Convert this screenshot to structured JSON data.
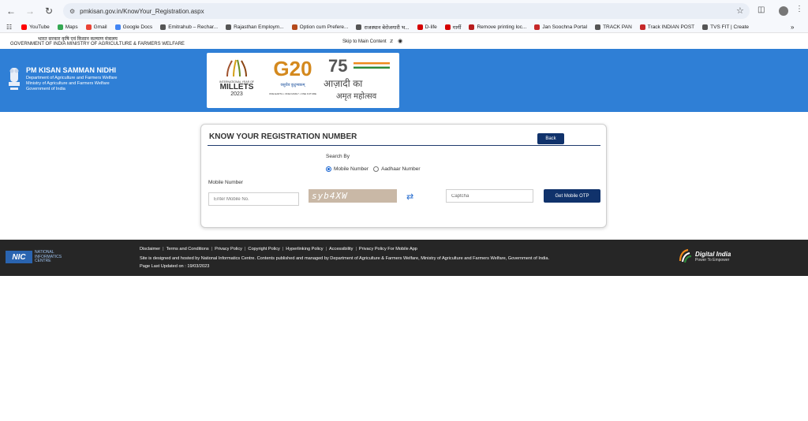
{
  "browser": {
    "url": "pmkisan.gov.in/KnowYour_Registration.aspx",
    "bookmarks": [
      {
        "label": "YouTube",
        "color": "#ff0000"
      },
      {
        "label": "Maps",
        "color": "#34a853"
      },
      {
        "label": "Gmail",
        "color": "#ea4335"
      },
      {
        "label": "Google Docs",
        "color": "#4285f4"
      },
      {
        "label": "Emitrahub – Rechar...",
        "color": "#555555"
      },
      {
        "label": "Rajasthan Employm...",
        "color": "#555555"
      },
      {
        "label": "Option cum Prefere...",
        "color": "#b4491b"
      },
      {
        "label": "राजस्थान बेरोजगारी भ...",
        "color": "#555555"
      },
      {
        "label": "D-life",
        "color": "#d50000"
      },
      {
        "label": "गार्गी",
        "color": "#d50000"
      },
      {
        "label": "Remove printing loc...",
        "color": "#b71c1c"
      },
      {
        "label": "Jan Soochna Portal",
        "color": "#c62828"
      },
      {
        "label": "TRACK PAN",
        "color": "#555555"
      },
      {
        "label": "Track INDIAN POST",
        "color": "#c62828"
      },
      {
        "label": "TVS FIT | Create",
        "color": "#555555"
      }
    ]
  },
  "gov": {
    "hindi_line": "भारत सरकार    कृषि एवं किसान कल्याण मंत्रालय",
    "english_line": "GOVERNMENT OF INDIA    MINISTRY OF AGRICULTURE & FARMERS WELFARE",
    "skip": "Skip to Main Content"
  },
  "banner": {
    "title": "PM KISAN SAMMAN NIDHI",
    "sub1": "Department of Agriculture and Farmers Welfare",
    "sub2": "Ministry of Agriculture and Farmers Welfare",
    "sub3": "Government of India",
    "millets_top": "INTERNATIONAL YEAR OF",
    "millets": "MILLETS",
    "millets_year": "2023",
    "g20": "G20",
    "g20_hindi": "वसुधैव कुटुम्बकम्",
    "g20_tag": "ONE EARTH • ONE FAMILY • ONE FUTURE",
    "akam_num": "75",
    "akam_line1": "आज़ादी का",
    "akam_line2": "अमृत महोत्सव"
  },
  "form": {
    "title": "KNOW YOUR REGISTRATION NUMBER",
    "back": "Back",
    "search_by": "Search By",
    "option_mobile": "Mobile Number",
    "option_aadhaar": "Aadhaar Number",
    "mobile_label": "Mobile Number",
    "mobile_placeholder": "Enter Mobile No.",
    "captcha_text": "syb4XW",
    "captcha_placeholder": "Captcha",
    "get_otp": "Get Mobile OTP"
  },
  "footer": {
    "links": [
      "Disclaimer",
      "Terms and Conditions",
      "Privacy Policy",
      "Copyright Policy",
      "Hyperlinking Policy",
      "Accessibility",
      "Privacy Policy For Mobile App"
    ],
    "hosted": "Site is designed and hosted by National Informatics Centre. Contents published and managed by Department of Agriculture & Farmers Welfare, Ministry of Agriculture and Farmers Welfare, Government of India.",
    "updated": "Page Last Updated on : 19/03/2023",
    "nic_short": "NIC",
    "nic_line1": "NATIONAL",
    "nic_line2": "INFORMATICS",
    "nic_line3": "CENTRE",
    "di_title": "Digital India",
    "di_tag": "Power To Empower"
  }
}
